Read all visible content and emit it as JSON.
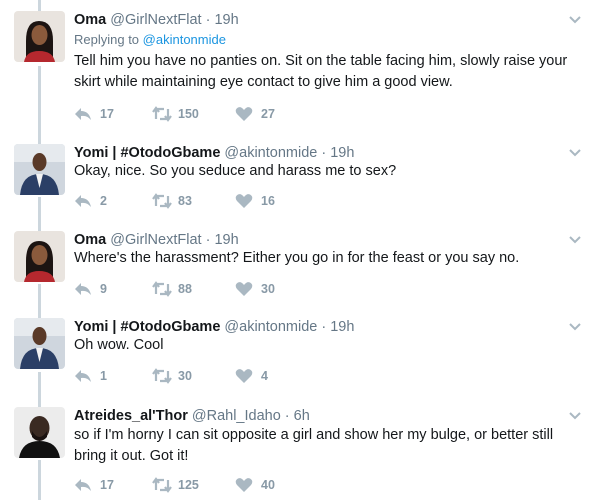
{
  "tweets": [
    {
      "name": "Oma",
      "handle": "@GirlNextFlat",
      "dot": "·",
      "time": "19h",
      "replying_label": "Replying to",
      "replying_to": "@akintonmide",
      "text": "Tell him you have no panties on. Sit on the table facing him, slowly raise your skirt while maintaining eye contact to give him a good view.",
      "replies": "17",
      "retweets": "150",
      "likes": "27"
    },
    {
      "name": "Yomi | #OtodoGbame",
      "handle": "@akintonmide",
      "dot": "·",
      "time": "19h",
      "text": "Okay,  nice.  So you seduce and harass me to sex?",
      "replies": "2",
      "retweets": "83",
      "likes": "16"
    },
    {
      "name": "Oma",
      "handle": "@GirlNextFlat",
      "dot": "·",
      "time": "19h",
      "text": "Where's the harassment? Either you go in for the feast or you say no.",
      "replies": "9",
      "retweets": "88",
      "likes": "30"
    },
    {
      "name": "Yomi | #OtodoGbame",
      "handle": "@akintonmide",
      "dot": "·",
      "time": "19h",
      "text": "Oh wow.  Cool",
      "replies": "1",
      "retweets": "30",
      "likes": "4"
    },
    {
      "name": "Atreides_al'Thor",
      "handle": "@Rahl_Idaho",
      "dot": "·",
      "time": "6h",
      "text": "so if I'm horny I can sit opposite a girl and show her my bulge, or better still bring it out. Got it!",
      "replies": "17",
      "retweets": "125",
      "likes": "40"
    }
  ],
  "icons": {
    "reply": "reply-icon",
    "retweet": "retweet-icon",
    "like": "heart-icon",
    "menu": "chevron-down-icon"
  },
  "colors": {
    "text": "#14171a",
    "muted": "#657786",
    "action": "#8899a6",
    "link": "#1b95e0",
    "thread": "#ccd6dd"
  }
}
